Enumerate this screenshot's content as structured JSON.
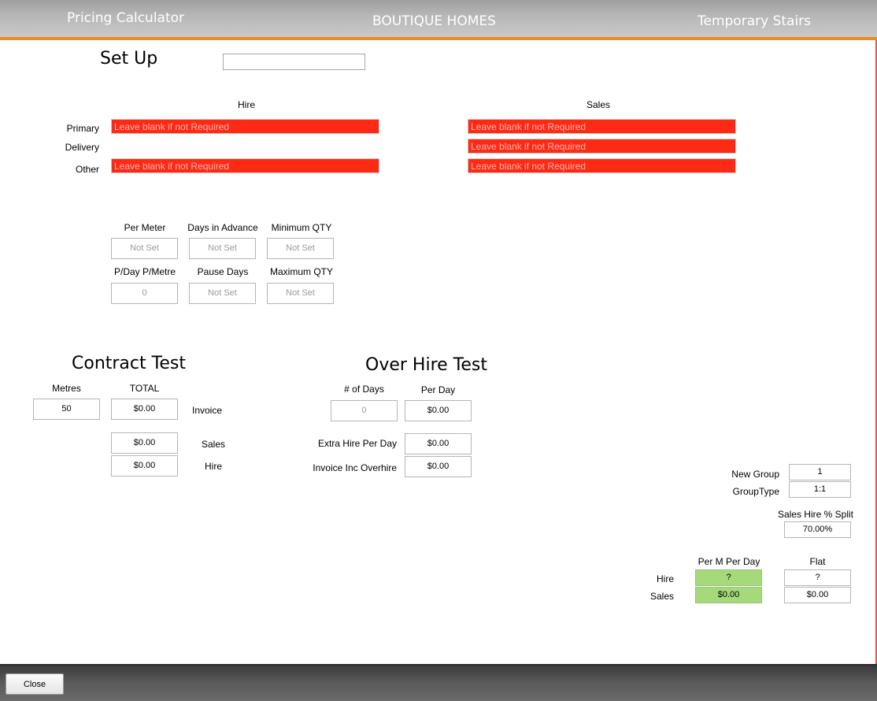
{
  "header": {
    "left_title": "Pricing Calculator",
    "center_title": "BOUTIQUE HOMES",
    "right_title": "Temporary Stairs"
  },
  "setup": {
    "heading": "Set Up",
    "name_value": "",
    "hire_header": "Hire",
    "sales_header": "Sales",
    "rows": {
      "primary": "Primary",
      "delivery": "Delivery",
      "other": "Other"
    },
    "placeholder": "Leave blank if not Required"
  },
  "params": {
    "per_meter_label": "Per Meter",
    "per_meter_value": "Not Set",
    "days_in_advance_label": "Days in Advance",
    "days_in_advance_value": "Not Set",
    "minimum_qty_label": "Minimum QTY",
    "minimum_qty_value": "Not Set",
    "pday_pmetre_label": "P/Day P/Metre",
    "pday_pmetre_value": "0",
    "pause_days_label": "Pause Days",
    "pause_days_value": "Not Set",
    "maximum_qty_label": "Maximum QTY",
    "maximum_qty_value": "Not Set"
  },
  "contract": {
    "heading": "Contract Test",
    "metres_label": "Metres",
    "metres_value": "50",
    "total_label": "TOTAL",
    "invoice_value": "$0.00",
    "invoice_label": "Invoice",
    "sales_value": "$0.00",
    "sales_label": "Sales",
    "hire_value": "$0.00",
    "hire_label": "Hire"
  },
  "overhire": {
    "heading": "Over Hire Test",
    "days_label": "# of Days",
    "days_value": "0",
    "per_day_label": "Per Day",
    "per_day_value": "$0.00",
    "extra_label": "Extra Hire Per Day",
    "extra_value": "$0.00",
    "invoice_label": "Invoice Inc Overhire",
    "invoice_value": "$0.00"
  },
  "group": {
    "new_group_label": "New Group",
    "new_group_value": "1",
    "group_type_label": "GroupType",
    "group_type_value": "1:1",
    "split_label": "Sales Hire % Split",
    "split_value": "70.00%",
    "per_m_per_day_label": "Per M Per Day",
    "flat_label": "Flat",
    "hire_label": "Hire",
    "sales_label": "Sales",
    "hire_per_m": "?",
    "sales_per_m": "$0.00",
    "hire_flat": "?",
    "sales_flat": "$0.00"
  },
  "footer": {
    "close_label": "Close"
  },
  "colors": {
    "accent_orange": "#f08a1c",
    "required_red": "#ff2a14",
    "result_green": "#a6d97a"
  }
}
